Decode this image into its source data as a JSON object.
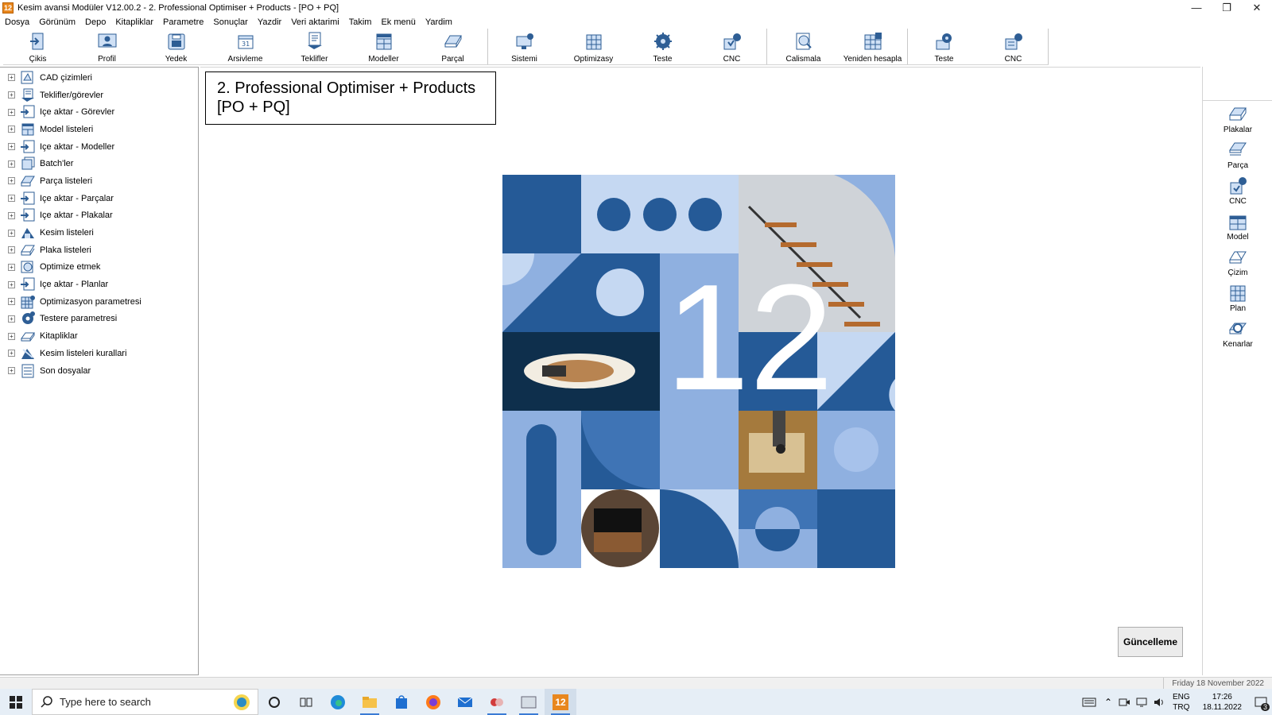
{
  "window": {
    "app_icon_text": "12",
    "title": "Kesim avansi Modüler V12.00.2 - 2. Professional Optimiser + Products - [PO + PQ]",
    "controls": [
      "minimize-icon",
      "restore-icon",
      "close-icon"
    ]
  },
  "menu": [
    "Dosya",
    "Görünüm",
    "Depo",
    "Kitapliklar",
    "Parametre",
    "Sonuçlar",
    "Yazdir",
    "Veri aktarimi",
    "Takim",
    "Ek menü",
    "Yardim"
  ],
  "toolbar": {
    "group1": [
      {
        "label": "Çikis",
        "icon": "exit-icon"
      },
      {
        "label": "Profil",
        "icon": "profile-icon"
      },
      {
        "label": "Yedek",
        "icon": "backup-icon"
      },
      {
        "label": "Arsivleme",
        "icon": "archive-icon"
      },
      {
        "label": "Teklifler",
        "icon": "quotes-icon"
      },
      {
        "label": "Modeller",
        "icon": "models-icon"
      },
      {
        "label": "Parçal",
        "icon": "parts-icon"
      }
    ],
    "group2": [
      {
        "label": "Sistemi",
        "icon": "system-icon"
      },
      {
        "label": "Optimizasy",
        "icon": "optimize-icon"
      },
      {
        "label": "Teste",
        "icon": "saw-icon"
      },
      {
        "label": "CNC",
        "icon": "cnc-icon"
      }
    ],
    "group3": [
      {
        "label": "Calismala",
        "icon": "work-icon"
      },
      {
        "label": "Yeniden hesapla",
        "icon": "recalculate-icon"
      }
    ],
    "group4": [
      {
        "label": "Teste",
        "icon": "saw-icon"
      },
      {
        "label": "CNC",
        "icon": "cnc-icon"
      }
    ]
  },
  "tree": [
    {
      "label": "CAD çizimleri",
      "icon": "cad-icon"
    },
    {
      "label": "Teklifler/görevler",
      "icon": "quotes-icon"
    },
    {
      "label": "Içe aktar - Görevler",
      "icon": "import-icon"
    },
    {
      "label": "Model listeleri",
      "icon": "models-icon"
    },
    {
      "label": "Içe aktar - Modeller",
      "icon": "import-icon"
    },
    {
      "label": "Batch'ler",
      "icon": "batch-icon"
    },
    {
      "label": "Parça listeleri",
      "icon": "parts-icon"
    },
    {
      "label": "Içe aktar - Parçalar",
      "icon": "import-icon"
    },
    {
      "label": "Içe aktar - Plakalar",
      "icon": "import-icon"
    },
    {
      "label": "Kesim listeleri",
      "icon": "cut-list-icon"
    },
    {
      "label": "Plaka listeleri",
      "icon": "boards-icon"
    },
    {
      "label": "Optimize etmek",
      "icon": "optimize-icon"
    },
    {
      "label": "Içe aktar - Planlar",
      "icon": "import-icon"
    },
    {
      "label": "Optimizasyon parametresi",
      "icon": "grid-settings-icon"
    },
    {
      "label": "Testere parametresi",
      "icon": "gear-icon"
    },
    {
      "label": "Kitapliklar",
      "icon": "library-icon"
    },
    {
      "label": "Kesim listeleri kurallari",
      "icon": "rules-icon"
    },
    {
      "label": "Son dosyalar",
      "icon": "recent-files-icon"
    }
  ],
  "main": {
    "title_line1": "2. Professional Optimiser + Products",
    "title_line2": "[PO + PQ]",
    "hero_number": "12",
    "update_button": "Güncelleme"
  },
  "right_panel": [
    {
      "label": "Plakalar",
      "icon": "boards-icon"
    },
    {
      "label": "Parça",
      "icon": "parts-icon"
    },
    {
      "label": "CNC",
      "icon": "cnc-icon"
    },
    {
      "label": "Model",
      "icon": "model-icon"
    },
    {
      "label": "Çizim",
      "icon": "drawing-icon"
    },
    {
      "label": "Plan",
      "icon": "plan-icon"
    },
    {
      "label": "Kenarlar",
      "icon": "edges-icon"
    }
  ],
  "status": {
    "date_text": "Friday 18 November 2022"
  },
  "taskbar": {
    "search_placeholder": "Type here to search",
    "language_line1": "ENG",
    "language_line2": "TRQ",
    "time": "17:26",
    "date": "18.11.2022",
    "notification_count": "3"
  },
  "colors": {
    "hero_dark": "#255a97",
    "hero_mid": "#3f74b5",
    "hero_light": "#8fb0e0",
    "hero_pale": "#c5d8f2",
    "icon_blue": "#2e5e95"
  }
}
